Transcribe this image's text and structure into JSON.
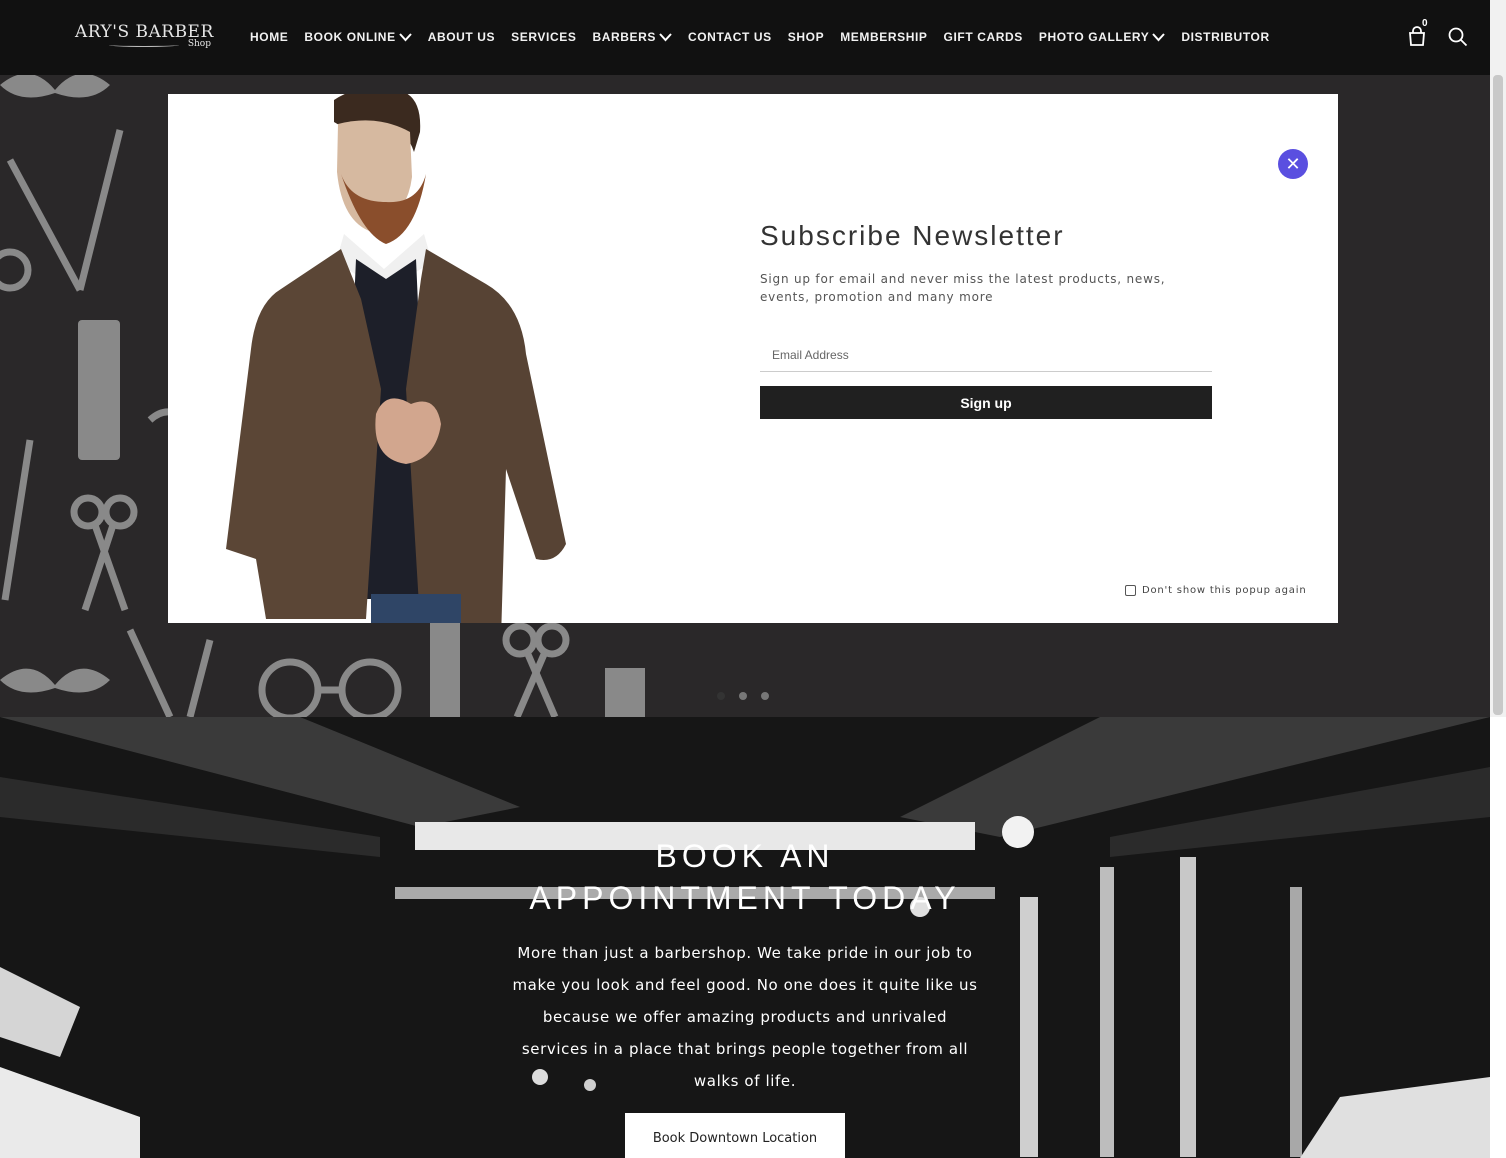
{
  "brand": {
    "name": "ARY'S BARBER",
    "sub": "Shop"
  },
  "nav": {
    "items": [
      {
        "label": "HOME",
        "dropdown": false
      },
      {
        "label": "BOOK ONLINE",
        "dropdown": true
      },
      {
        "label": "ABOUT US",
        "dropdown": false
      },
      {
        "label": "SERVICES",
        "dropdown": false
      },
      {
        "label": "BARBERS",
        "dropdown": true
      },
      {
        "label": "CONTACT US",
        "dropdown": false
      },
      {
        "label": "SHOP",
        "dropdown": false
      },
      {
        "label": "MEMBERSHIP",
        "dropdown": false
      },
      {
        "label": "GIFT CARDS",
        "dropdown": false
      },
      {
        "label": "PHOTO GALLERY",
        "dropdown": true
      },
      {
        "label": "DISTRIBUTOR",
        "dropdown": false
      }
    ],
    "cart_count": "0",
    "cart_icon": "shopping-bag-icon",
    "search_icon": "search-icon"
  },
  "popup": {
    "close_icon": "close-icon",
    "title": "Subscribe Newsletter",
    "description": "Sign up for email and never miss the latest products, news, events, promotion and many more",
    "email_placeholder": "Email Address",
    "email_value": "",
    "signup_label": "Sign up",
    "dont_show_label": "Don't show this popup again",
    "dont_show_checked": false
  },
  "slider": {
    "dots": 3,
    "active": 0
  },
  "booking": {
    "title_line1": "BOOK AN",
    "title_line2": "APPOINTMENT TODAY",
    "text": "More than just a barbershop. We take pride in our job to make you look and feel good. No one does it quite like us because we offer amazing products and unrivaled services in a place that brings people together from all walks of life.",
    "button_label": "Book Downtown Location"
  },
  "colors": {
    "accent": "#5a4fe0",
    "header_bg": "#111111",
    "button_dark": "#202020"
  }
}
